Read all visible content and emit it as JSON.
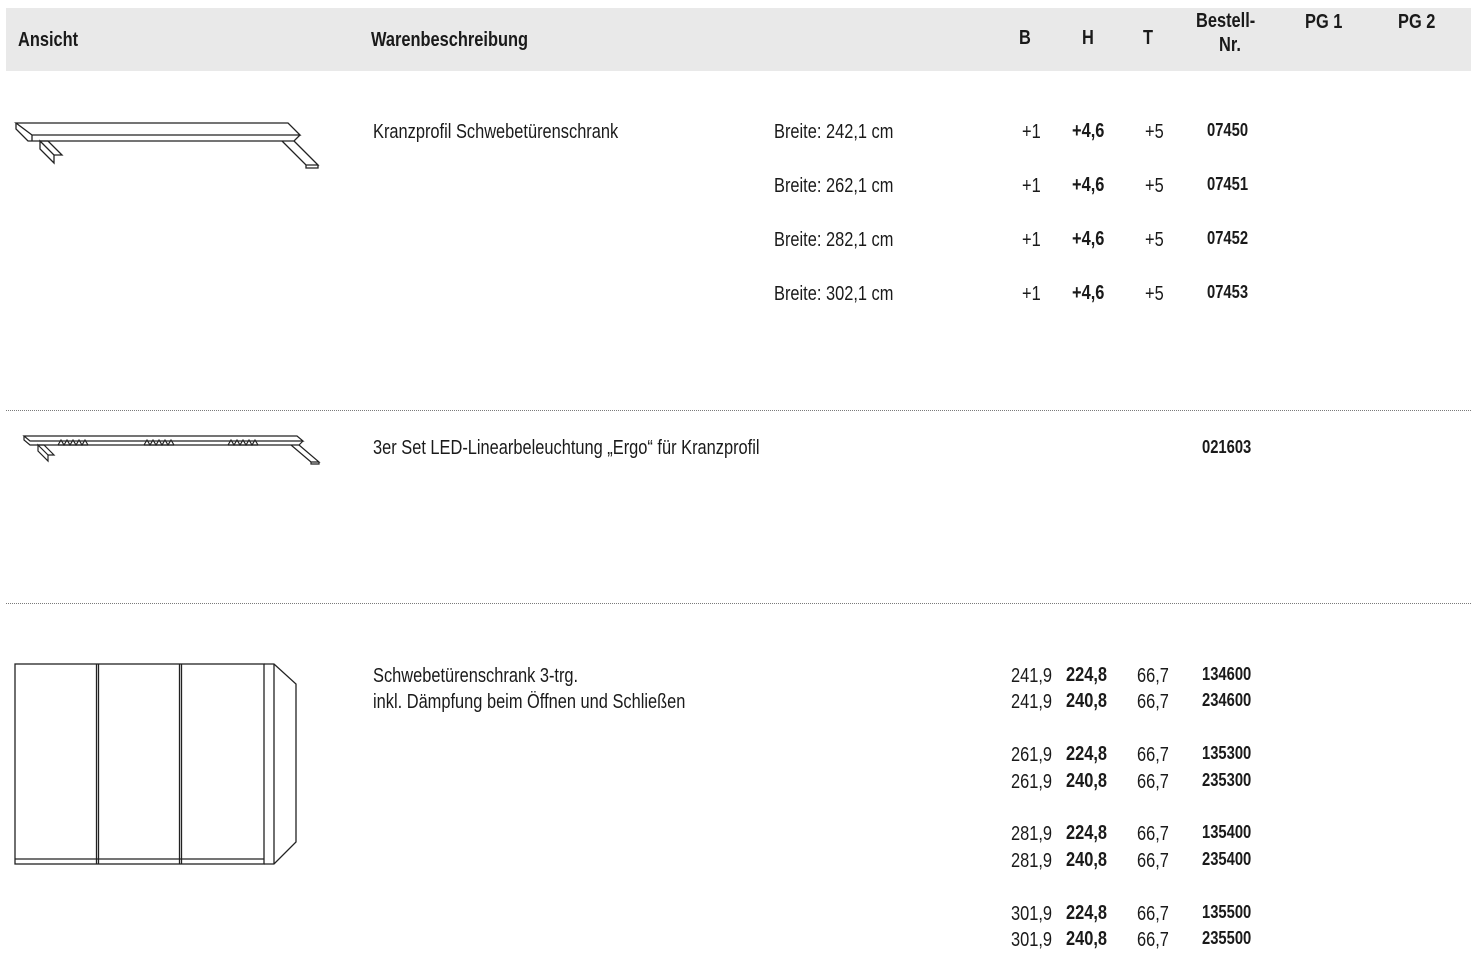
{
  "header": {
    "ansicht": "Ansicht",
    "warenbeschreibung": "Warenbeschreibung",
    "b": "B",
    "h": "H",
    "t": "T",
    "bestell_1": "Bestell-",
    "bestell_2": "Nr.",
    "pg1": "PG 1",
    "pg2": "PG 2"
  },
  "section1": {
    "title": "Kranzprofil Schwebetürenschrank",
    "rows": [
      {
        "breite": "Breite: 242,1 cm",
        "b": "+1",
        "h": "+4,6",
        "t": "+5",
        "nr": "07450"
      },
      {
        "breite": "Breite: 262,1 cm",
        "b": "+1",
        "h": "+4,6",
        "t": "+5",
        "nr": "07451"
      },
      {
        "breite": "Breite: 282,1 cm",
        "b": "+1",
        "h": "+4,6",
        "t": "+5",
        "nr": "07452"
      },
      {
        "breite": "Breite: 302,1 cm",
        "b": "+1",
        "h": "+4,6",
        "t": "+5",
        "nr": "07453"
      }
    ]
  },
  "section2": {
    "title": "3er Set LED-Linearbeleuchtung „Ergo“ für Kranzprofil",
    "nr": "021603"
  },
  "section3": {
    "title_1": "Schwebetürenschrank 3-trg.",
    "title_2": "inkl. Dämpfung beim Öffnen und Schließen",
    "rows": [
      {
        "b": "241,9",
        "h": "224,8",
        "t": "66,7",
        "nr": "134600"
      },
      {
        "b": "241,9",
        "h": "240,8",
        "t": "66,7",
        "nr": "234600"
      },
      {
        "b": "261,9",
        "h": "224,8",
        "t": "66,7",
        "nr": "135300"
      },
      {
        "b": "261,9",
        "h": "240,8",
        "t": "66,7",
        "nr": "235300"
      },
      {
        "b": "281,9",
        "h": "224,8",
        "t": "66,7",
        "nr": "135400"
      },
      {
        "b": "281,9",
        "h": "240,8",
        "t": "66,7",
        "nr": "235400"
      },
      {
        "b": "301,9",
        "h": "224,8",
        "t": "66,7",
        "nr": "135500"
      },
      {
        "b": "301,9",
        "h": "240,8",
        "t": "66,7",
        "nr": "235500"
      }
    ]
  }
}
